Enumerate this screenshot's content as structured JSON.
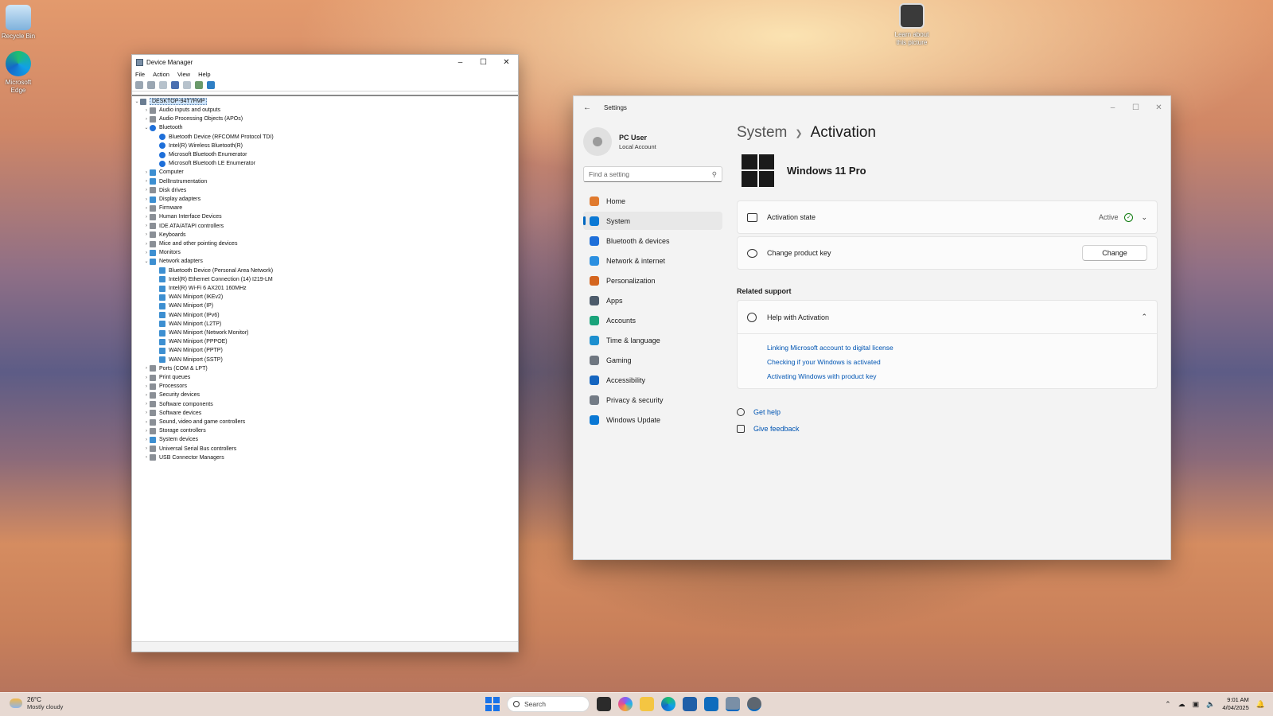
{
  "desktop": {
    "icons": [
      {
        "label": "Recycle Bin"
      },
      {
        "label": "Microsoft Edge"
      },
      {
        "label": "Learn about this picture"
      }
    ]
  },
  "device_manager": {
    "title": "Device Manager",
    "menu": [
      "File",
      "Action",
      "View",
      "Help"
    ],
    "root": "DESKTOP-94T7FMP",
    "tree": [
      {
        "label": "Audio inputs and outputs",
        "level": 1,
        "expanded": false,
        "icon": "gen"
      },
      {
        "label": "Audio Processing Objects (APOs)",
        "level": 1,
        "expanded": false,
        "icon": "gen"
      },
      {
        "label": "Bluetooth",
        "level": 1,
        "expanded": true,
        "icon": "bt"
      },
      {
        "label": "Bluetooth Device (RFCOMM Protocol TDI)",
        "level": 2,
        "icon": "bt"
      },
      {
        "label": "Intel(R) Wireless Bluetooth(R)",
        "level": 2,
        "icon": "bt"
      },
      {
        "label": "Microsoft Bluetooth Enumerator",
        "level": 2,
        "icon": "bt"
      },
      {
        "label": "Microsoft Bluetooth LE Enumerator",
        "level": 2,
        "icon": "bt"
      },
      {
        "label": "Computer",
        "level": 1,
        "expanded": false,
        "icon": "net"
      },
      {
        "label": "DellInstrumentation",
        "level": 1,
        "expanded": false,
        "icon": "net"
      },
      {
        "label": "Disk drives",
        "level": 1,
        "expanded": false,
        "icon": "gen"
      },
      {
        "label": "Display adapters",
        "level": 1,
        "expanded": false,
        "icon": "net"
      },
      {
        "label": "Firmware",
        "level": 1,
        "expanded": false,
        "icon": "gen"
      },
      {
        "label": "Human Interface Devices",
        "level": 1,
        "expanded": false,
        "icon": "gen"
      },
      {
        "label": "IDE ATA/ATAPI controllers",
        "level": 1,
        "expanded": false,
        "icon": "gen"
      },
      {
        "label": "Keyboards",
        "level": 1,
        "expanded": false,
        "icon": "gen"
      },
      {
        "label": "Mice and other pointing devices",
        "level": 1,
        "expanded": false,
        "icon": "gen"
      },
      {
        "label": "Monitors",
        "level": 1,
        "expanded": false,
        "icon": "net"
      },
      {
        "label": "Network adapters",
        "level": 1,
        "expanded": true,
        "icon": "net"
      },
      {
        "label": "Bluetooth Device (Personal Area Network)",
        "level": 2,
        "icon": "net"
      },
      {
        "label": "Intel(R) Ethernet Connection (14) I219-LM",
        "level": 2,
        "icon": "net"
      },
      {
        "label": "Intel(R) Wi-Fi 6 AX201 160MHz",
        "level": 2,
        "icon": "net"
      },
      {
        "label": "WAN Miniport (IKEv2)",
        "level": 2,
        "icon": "net"
      },
      {
        "label": "WAN Miniport (IP)",
        "level": 2,
        "icon": "net"
      },
      {
        "label": "WAN Miniport (IPv6)",
        "level": 2,
        "icon": "net"
      },
      {
        "label": "WAN Miniport (L2TP)",
        "level": 2,
        "icon": "net"
      },
      {
        "label": "WAN Miniport (Network Monitor)",
        "level": 2,
        "icon": "net"
      },
      {
        "label": "WAN Miniport (PPPOE)",
        "level": 2,
        "icon": "net"
      },
      {
        "label": "WAN Miniport (PPTP)",
        "level": 2,
        "icon": "net"
      },
      {
        "label": "WAN Miniport (SSTP)",
        "level": 2,
        "icon": "net"
      },
      {
        "label": "Ports (COM & LPT)",
        "level": 1,
        "expanded": false,
        "icon": "gen"
      },
      {
        "label": "Print queues",
        "level": 1,
        "expanded": false,
        "icon": "gen"
      },
      {
        "label": "Processors",
        "level": 1,
        "expanded": false,
        "icon": "gen"
      },
      {
        "label": "Security devices",
        "level": 1,
        "expanded": false,
        "icon": "gen"
      },
      {
        "label": "Software components",
        "level": 1,
        "expanded": false,
        "icon": "gen"
      },
      {
        "label": "Software devices",
        "level": 1,
        "expanded": false,
        "icon": "gen"
      },
      {
        "label": "Sound, video and game controllers",
        "level": 1,
        "expanded": false,
        "icon": "gen"
      },
      {
        "label": "Storage controllers",
        "level": 1,
        "expanded": false,
        "icon": "gen"
      },
      {
        "label": "System devices",
        "level": 1,
        "expanded": false,
        "icon": "net"
      },
      {
        "label": "Universal Serial Bus controllers",
        "level": 1,
        "expanded": false,
        "icon": "gen"
      },
      {
        "label": "USB Connector Managers",
        "level": 1,
        "expanded": false,
        "icon": "gen"
      }
    ]
  },
  "settings": {
    "title": "Settings",
    "user": {
      "name": "PC User",
      "account": "Local Account"
    },
    "search_placeholder": "Find a setting",
    "nav": [
      {
        "label": "Home",
        "icon": "home-icon",
        "color": "#e07a2e"
      },
      {
        "label": "System",
        "icon": "system-icon",
        "color": "#0a78d4",
        "selected": true
      },
      {
        "label": "Bluetooth & devices",
        "icon": "bluetooth-icon",
        "color": "#1e6fd9"
      },
      {
        "label": "Network & internet",
        "icon": "wifi-icon",
        "color": "#2b8fe0"
      },
      {
        "label": "Personalization",
        "icon": "brush-icon",
        "color": "#d4651f"
      },
      {
        "label": "Apps",
        "icon": "apps-icon",
        "color": "#4d5b6b"
      },
      {
        "label": "Accounts",
        "icon": "person-icon",
        "color": "#1aa37a"
      },
      {
        "label": "Time & language",
        "icon": "globe-clock-icon",
        "color": "#1d8fcf"
      },
      {
        "label": "Gaming",
        "icon": "gamepad-icon",
        "color": "#6f7680"
      },
      {
        "label": "Accessibility",
        "icon": "accessibility-icon",
        "color": "#1565c0"
      },
      {
        "label": "Privacy & security",
        "icon": "shield-icon",
        "color": "#737b85"
      },
      {
        "label": "Windows Update",
        "icon": "update-icon",
        "color": "#0a78d4"
      }
    ],
    "breadcrumb": {
      "parent": "System",
      "current": "Activation"
    },
    "edition": "Windows 11 Pro",
    "activation_state": {
      "label": "Activation state",
      "value": "Active"
    },
    "product_key": {
      "label": "Change product key",
      "button": "Change"
    },
    "related_support": "Related support",
    "help": {
      "title": "Help with Activation",
      "links": [
        "Linking Microsoft account to digital license",
        "Checking if your Windows is activated",
        "Activating Windows with product key"
      ]
    },
    "footer": {
      "get_help": "Get help",
      "give_feedback": "Give feedback"
    }
  },
  "taskbar": {
    "weather_temp": "26°C",
    "weather_desc": "Mostly cloudy",
    "search_label": "Search",
    "time": "9:01 AM",
    "date": "4/04/2025"
  }
}
